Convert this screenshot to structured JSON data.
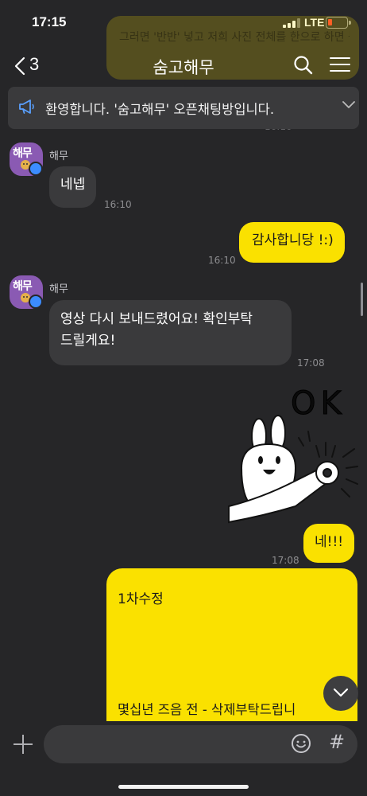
{
  "status": {
    "time": "17:15",
    "network": "LTE"
  },
  "ghost": {
    "text": "그러면 '반반' 넣고 저희 사진 전체를 한으로 하면 될까요?!"
  },
  "header": {
    "back_count": "3",
    "title": "숨고해무"
  },
  "notice": {
    "text": "환영합니다. '숨고해무' 오픈채팅방입니다."
  },
  "chat": {
    "partial_time": "16:10",
    "messages": [
      {
        "type": "in",
        "sender": "해무",
        "avatar_text": "해무",
        "text": "네넵",
        "time": "16:10"
      },
      {
        "type": "out",
        "text": "감사합니당 !:)",
        "time": "16:10"
      },
      {
        "type": "in",
        "sender": "해무",
        "avatar_text": "해무",
        "text_line1": "영상 다시 보내드렸어요! 확인부탁",
        "text_line2": "드릴게요!",
        "time": "17:08"
      },
      {
        "type": "sticker",
        "caption": "OK"
      },
      {
        "type": "out",
        "text": "네!!!",
        "time": "17:08"
      },
      {
        "type": "out_long",
        "line1": "1차수정",
        "line2": "몇십년 즈음 전 -  삭제부탁드립니"
      }
    ]
  },
  "input": {
    "placeholder": "",
    "hash": "#"
  },
  "colors": {
    "accent": "#fae100",
    "background": "#262628",
    "bubble_in": "#3a3a3c",
    "avatar": "#8a5ab3"
  }
}
